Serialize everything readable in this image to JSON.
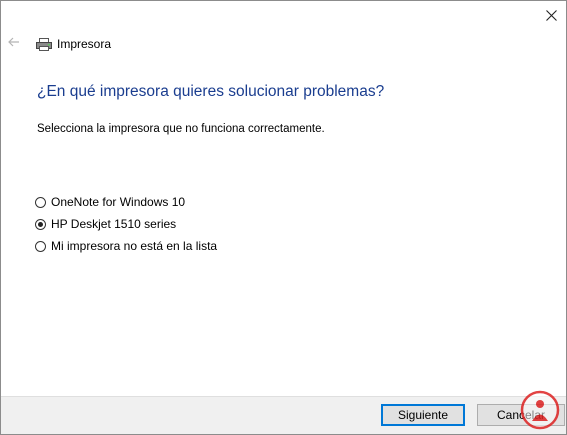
{
  "window": {
    "close_glyph": "✕"
  },
  "header": {
    "title": "Impresora",
    "back_icon": "back-arrow-icon",
    "app_icon": "printer-icon"
  },
  "main": {
    "heading": "¿En qué impresora quieres solucionar problemas?",
    "instruction": "Selecciona la impresora que no funciona correctamente."
  },
  "options": [
    {
      "label": "OneNote for Windows 10",
      "selected": false
    },
    {
      "label": "HP Deskjet 1510 series",
      "selected": true
    },
    {
      "label": "Mi impresora no está en la lista",
      "selected": false
    }
  ],
  "footer": {
    "next_label": "Siguiente",
    "cancel_label": "Cancelar"
  },
  "colors": {
    "heading": "#1a3d8f",
    "focus_border": "#0078d7",
    "footer_bg": "#f0f0f0"
  }
}
